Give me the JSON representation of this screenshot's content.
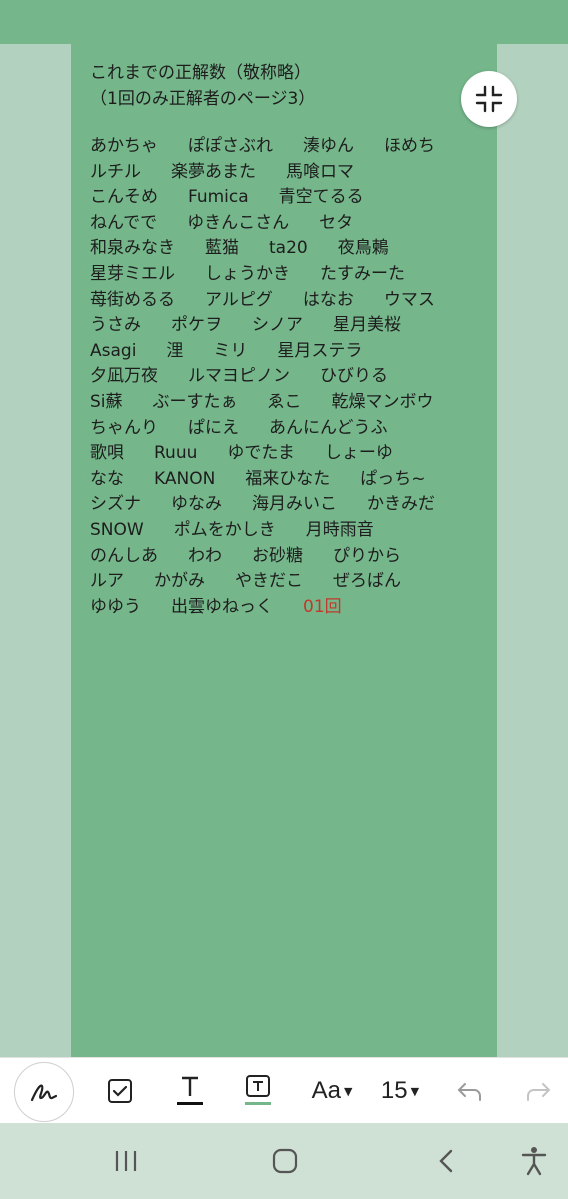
{
  "colors": {
    "page_background": "#75b68b",
    "margin_background": "#b3d1bf",
    "count_text": "#c0392b",
    "underline_accent": "#75b68b"
  },
  "note": {
    "title_line1": "これまでの正解数（敬称略）",
    "title_line2": "（1回のみ正解者のページ3）",
    "rows": [
      [
        "あかちゃ",
        "ぽぽさぶれ",
        "湊ゆん",
        "ほめち"
      ],
      [
        "ルチル",
        "楽夢あまた",
        "馬喰ロマ"
      ],
      [
        "こんそめ",
        "Fumica",
        "青空てるる"
      ],
      [
        "ねんでで",
        "ゆきんこさん",
        "セタ"
      ],
      [
        "和泉みなき",
        "藍猫",
        "ta20",
        "夜鳥鶫"
      ],
      [
        "星芽ミエル",
        "しょうかき",
        "たすみーた"
      ],
      [
        "苺街めるる",
        "アルピグ",
        "はなお",
        "ウマス"
      ],
      [
        "うさみ",
        "ポケヲ",
        "シノア",
        "星月美桜"
      ],
      [
        "Asagi",
        "浬",
        "ミリ",
        "星月ステラ"
      ],
      [
        "夕凪万夜",
        "ルマヨピノン",
        "ひびりる"
      ],
      [
        "Si蘇",
        "ぶーすたぁ",
        "ゑこ",
        "乾燥マンボウ"
      ],
      [
        "ちゃんり",
        "ぱにえ",
        "あんにんどうふ"
      ],
      [
        "歌唄",
        "Ruuu",
        "ゆでたま",
        "しょーゆ"
      ],
      [
        "なな",
        "KANON",
        "福来ひなた",
        "ぱっち~"
      ],
      [
        "シズナ",
        "ゆなみ",
        "海月みいこ",
        "かきみだ"
      ],
      [
        "SNOW",
        "ポムをかしき",
        "月時雨音"
      ],
      [
        "のんしあ",
        "わわ",
        "お砂糖",
        "ぴりから"
      ],
      [
        "ルア",
        "かがみ",
        "やきだこ",
        "ぜろばん"
      ],
      [
        "ゆゆう",
        "出雲ゆねっく"
      ]
    ],
    "count_label": "01回"
  },
  "toolbar": {
    "font_label": "Aa",
    "font_size": "15",
    "icons": [
      "pen-icon",
      "checkbox-icon",
      "text-color-icon",
      "text-highlight-icon",
      "undo-icon",
      "redo-icon"
    ]
  },
  "navbar": {
    "icons": [
      "recent-apps-icon",
      "home-icon",
      "back-icon",
      "accessibility-icon"
    ]
  }
}
